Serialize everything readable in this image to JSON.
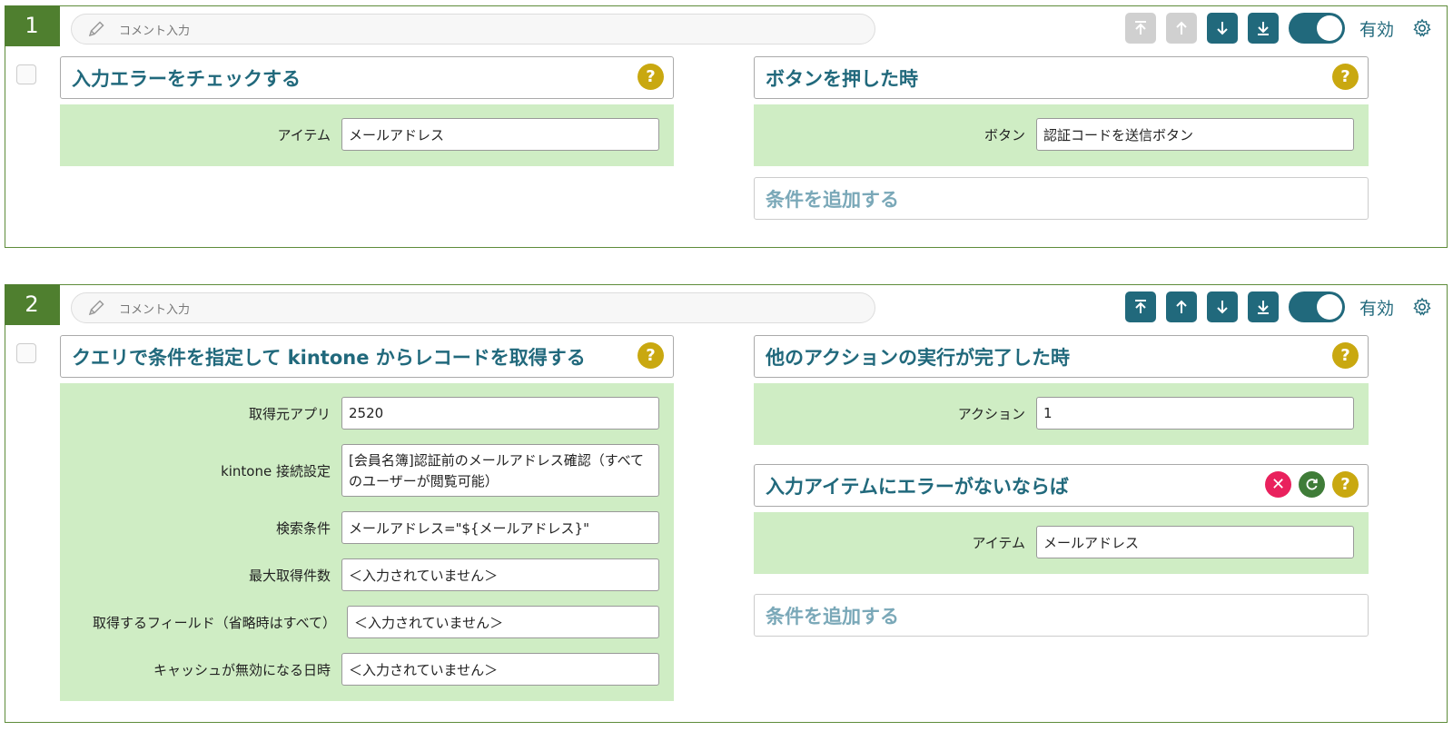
{
  "colors": {
    "accent": "#21697c",
    "rule_border": "#5e8c3a",
    "panel_bg": "#cfedc4",
    "help": "#c9a810",
    "delete": "#e9215d"
  },
  "rules": [
    {
      "number": "1",
      "comment_placeholder": "コメント入力",
      "toolbar": {
        "move_top_enabled": false,
        "move_up_enabled": false,
        "move_down_enabled": true,
        "move_bottom_enabled": true,
        "toggle_label": "有効",
        "toggle_on": true
      },
      "action": {
        "title": "入力エラーをチェックする",
        "fields": [
          {
            "label": "アイテム",
            "value": "メールアドレス"
          }
        ]
      },
      "trigger": {
        "title": "ボタンを押した時",
        "fields": [
          {
            "label": "ボタン",
            "value": "認証コードを送信ボタン"
          }
        ]
      },
      "add_condition_label": "条件を追加する"
    },
    {
      "number": "2",
      "comment_placeholder": "コメント入力",
      "toolbar": {
        "move_top_enabled": true,
        "move_up_enabled": true,
        "move_down_enabled": true,
        "move_bottom_enabled": true,
        "toggle_label": "有効",
        "toggle_on": true
      },
      "action": {
        "title": "クエリで条件を指定して kintone からレコードを取得する",
        "fields": [
          {
            "label": "取得元アプリ",
            "value": "2520"
          },
          {
            "label": "kintone 接続設定",
            "value": "[会員名簿]認証前のメールアドレス確認（すべてのユーザーが閲覧可能）"
          },
          {
            "label": "検索条件",
            "value": "メールアドレス=\"${メールアドレス}\""
          },
          {
            "label": "最大取得件数",
            "value": "＜入力されていません＞"
          },
          {
            "label": "取得するフィールド（省略時はすべて）",
            "value": "＜入力されていません＞"
          },
          {
            "label": "キャッシュが無効になる日時",
            "value": "＜入力されていません＞"
          }
        ]
      },
      "trigger": {
        "title": "他のアクションの実行が完了した時",
        "fields": [
          {
            "label": "アクション",
            "value": "1"
          }
        ]
      },
      "condition": {
        "title": "入力アイテムにエラーがないならば",
        "fields": [
          {
            "label": "アイテム",
            "value": "メールアドレス"
          }
        ]
      },
      "add_condition_label": "条件を追加する"
    }
  ]
}
